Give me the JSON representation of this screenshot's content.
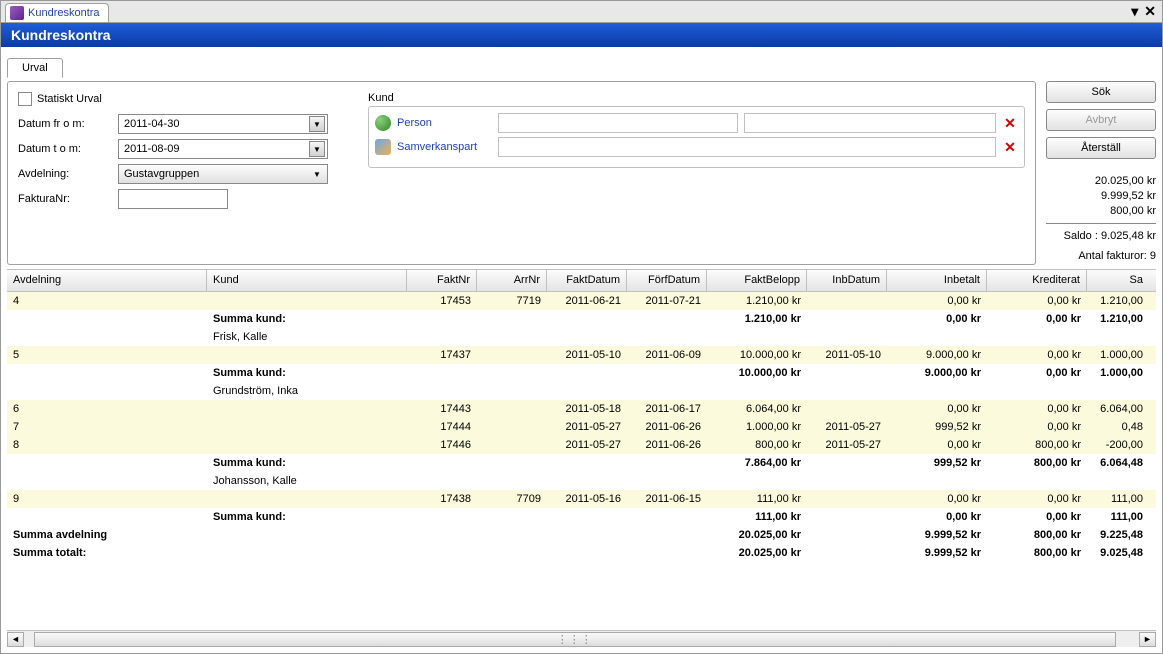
{
  "outerTab": {
    "label": "Kundreskontra"
  },
  "title": "Kundreskontra",
  "innerTab": "Urval",
  "filters": {
    "statisktUrvalLabel": "Statiskt Urval",
    "datumFromLabel": "Datum fr o m:",
    "datumFrom": "2011-04-30",
    "datumToLabel": "Datum t o m:",
    "datumTo": "2011-08-09",
    "avdelningLabel": "Avdelning:",
    "avdelning": "Gustavgruppen",
    "fakturaNrLabel": "FakturaNr:",
    "fakturaNr": ""
  },
  "kund": {
    "title": "Kund",
    "personLabel": "Person",
    "partnerLabel": "Samverkanspart"
  },
  "buttons": {
    "search": "Sök",
    "cancel": "Avbryt",
    "reset": "Återställ"
  },
  "summary": {
    "line1": "20.025,00 kr",
    "line2": "9.999,52 kr",
    "line3": "800,00 kr",
    "saldo": "Saldo : 9.025,48 kr",
    "antal": "Antal fakturor: 9"
  },
  "headers": {
    "avdelning": "Avdelning",
    "kund": "Kund",
    "faktnr": "FaktNr",
    "arrnr": "ArrNr",
    "faktdatum": "FaktDatum",
    "forfdatum": "FörfDatum",
    "faktbelopp": "FaktBelopp",
    "inbdatum": "InbDatum",
    "inbetalt": "Inbetalt",
    "krediterat": "Krediterat",
    "saldo": "Sa"
  },
  "rows": [
    {
      "type": "data",
      "yellow": true,
      "avd": "4",
      "kund": "",
      "faktnr": "17453",
      "arrnr": "7719",
      "faktdat": "2011-06-21",
      "forfdat": "2011-07-21",
      "faktbel": "1.210,00 kr",
      "inbdat": "",
      "inbet": "0,00 kr",
      "kred": "0,00 kr",
      "saldo": "1.210,00"
    },
    {
      "type": "sum",
      "avd": "",
      "kund": "Summa kund:",
      "faktbel": "1.210,00 kr",
      "inbet": "0,00 kr",
      "kred": "0,00 kr",
      "saldo": "1.210,00"
    },
    {
      "type": "name",
      "kund": "Frisk, Kalle"
    },
    {
      "type": "data",
      "yellow": true,
      "avd": "5",
      "kund": "",
      "faktnr": "17437",
      "arrnr": "",
      "faktdat": "2011-05-10",
      "forfdat": "2011-06-09",
      "faktbel": "10.000,00 kr",
      "inbdat": "2011-05-10",
      "inbet": "9.000,00 kr",
      "kred": "0,00 kr",
      "saldo": "1.000,00"
    },
    {
      "type": "sum",
      "avd": "",
      "kund": "Summa kund:",
      "faktbel": "10.000,00 kr",
      "inbet": "9.000,00 kr",
      "kred": "0,00 kr",
      "saldo": "1.000,00"
    },
    {
      "type": "name",
      "kund": "Grundström, Inka"
    },
    {
      "type": "data",
      "yellow": true,
      "avd": "6",
      "kund": "",
      "faktnr": "17443",
      "arrnr": "",
      "faktdat": "2011-05-18",
      "forfdat": "2011-06-17",
      "faktbel": "6.064,00 kr",
      "inbdat": "",
      "inbet": "0,00 kr",
      "kred": "0,00 kr",
      "saldo": "6.064,00"
    },
    {
      "type": "data",
      "yellow": true,
      "avd": "7",
      "kund": "",
      "faktnr": "17444",
      "arrnr": "",
      "faktdat": "2011-05-27",
      "forfdat": "2011-06-26",
      "faktbel": "1.000,00 kr",
      "inbdat": "2011-05-27",
      "inbet": "999,52 kr",
      "kred": "0,00 kr",
      "saldo": "0,48"
    },
    {
      "type": "data",
      "yellow": true,
      "avd": "8",
      "kund": "",
      "faktnr": "17446",
      "arrnr": "",
      "faktdat": "2011-05-27",
      "forfdat": "2011-06-26",
      "faktbel": "800,00 kr",
      "inbdat": "2011-05-27",
      "inbet": "0,00 kr",
      "kred": "800,00 kr",
      "saldo": "-200,00"
    },
    {
      "type": "sum",
      "avd": "",
      "kund": "Summa kund:",
      "faktbel": "7.864,00 kr",
      "inbet": "999,52 kr",
      "kred": "800,00 kr",
      "saldo": "6.064,48"
    },
    {
      "type": "name",
      "kund": "Johansson, Kalle"
    },
    {
      "type": "data",
      "yellow": true,
      "avd": "9",
      "kund": "",
      "faktnr": "17438",
      "arrnr": "7709",
      "faktdat": "2011-05-16",
      "forfdat": "2011-06-15",
      "faktbel": "111,00 kr",
      "inbdat": "",
      "inbet": "0,00 kr",
      "kred": "0,00 kr",
      "saldo": "111,00"
    },
    {
      "type": "sum",
      "avd": "",
      "kund": "Summa kund:",
      "faktbel": "111,00 kr",
      "inbet": "0,00 kr",
      "kred": "0,00 kr",
      "saldo": "111,00"
    },
    {
      "type": "sum",
      "avd": "Summa avdelning",
      "kund": "",
      "faktbel": "20.025,00 kr",
      "inbet": "9.999,52 kr",
      "kred": "800,00 kr",
      "saldo": "9.225,48"
    },
    {
      "type": "sum",
      "avd": "Summa totalt:",
      "kund": "",
      "faktbel": "20.025,00 kr",
      "inbet": "9.999,52 kr",
      "kred": "800,00 kr",
      "saldo": "9.025,48"
    }
  ]
}
